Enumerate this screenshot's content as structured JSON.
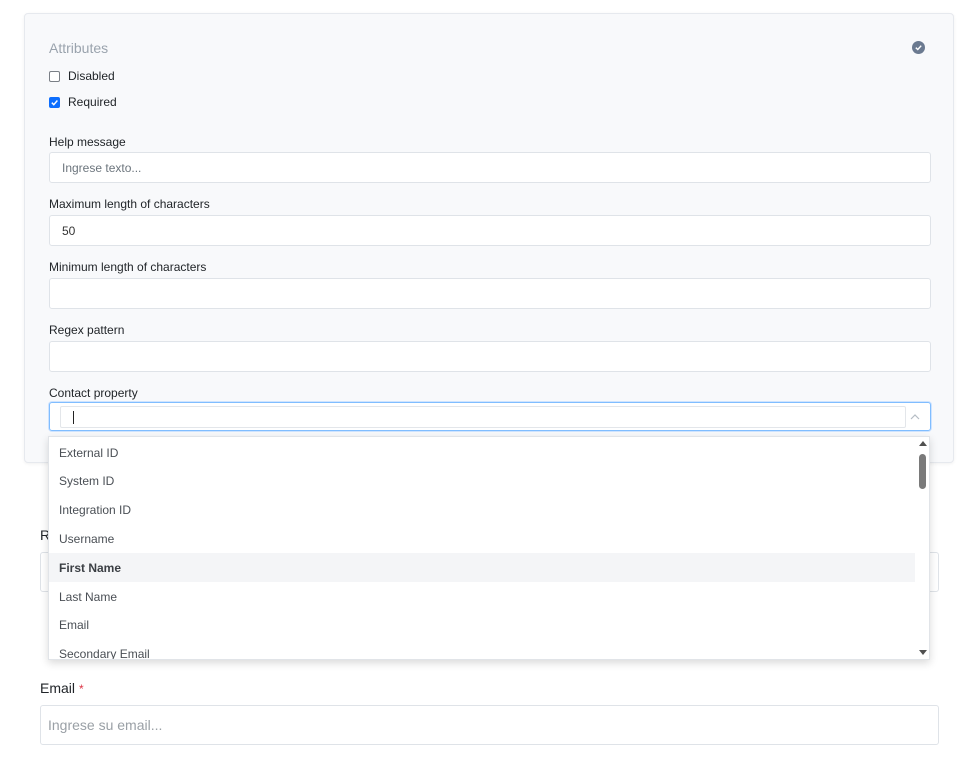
{
  "attributes": {
    "title": "Attributes",
    "disabled_label": "Disabled",
    "disabled_checked": false,
    "required_label": "Required",
    "required_checked": true,
    "help_message": {
      "label": "Help message",
      "placeholder": "Ingrese texto..."
    },
    "max_length": {
      "label": "Maximum length of characters",
      "value": "50"
    },
    "min_length": {
      "label": "Minimum length of characters",
      "value": ""
    },
    "regex": {
      "label": "Regex pattern",
      "value": ""
    },
    "contact_property": {
      "label": "Contact property",
      "value": ""
    }
  },
  "dropdown": {
    "options": [
      "External ID",
      "System ID",
      "Integration ID",
      "Username",
      "First Name",
      "Last Name",
      "Email",
      "Secondary Email"
    ],
    "highlighted": "First Name"
  },
  "behind": {
    "label_fragment": "R"
  },
  "email_field": {
    "label": "Email",
    "required_mark": "*",
    "placeholder": "Ingrese su email..."
  },
  "colors": {
    "accent": "#0d6efd",
    "focus_border": "#80bdff",
    "required": "#dc3545",
    "badge": "#6b7a90"
  }
}
